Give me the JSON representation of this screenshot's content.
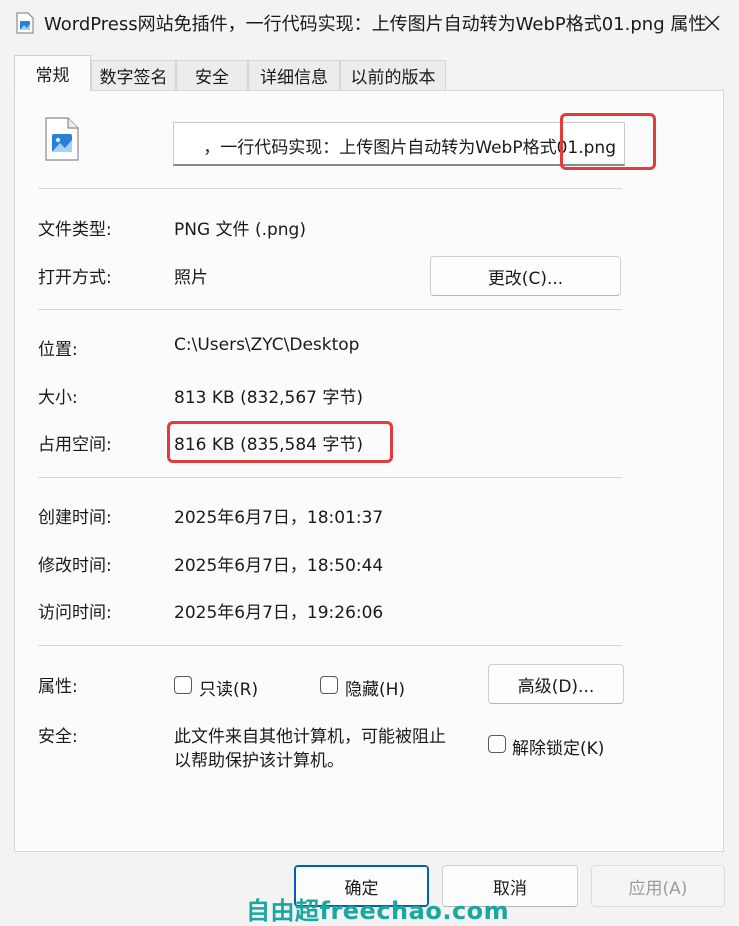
{
  "window": {
    "title": "WordPress网站免插件，一行代码实现：上传图片自动转为WebP格式01.png 属性",
    "close_icon": "close-icon"
  },
  "tabs": [
    {
      "label": "常规",
      "active": true
    },
    {
      "label": "数字签名",
      "active": false
    },
    {
      "label": "安全",
      "active": false
    },
    {
      "label": "详细信息",
      "active": false
    },
    {
      "label": "以前的版本",
      "active": false
    }
  ],
  "file": {
    "icon": "image-file-icon",
    "name_visible": "，一行代码实现：上传图片自动转为WebP格式01.png"
  },
  "info": {
    "type_label": "文件类型:",
    "type_value": "PNG 文件 (.png)",
    "open_label": "打开方式:",
    "open_value": "照片",
    "change_button": "更改(C)...",
    "location_label": "位置:",
    "location_value": "C:\\Users\\ZYC\\Desktop",
    "size_label": "大小:",
    "size_value": "813 KB (832,567 字节)",
    "disk_label": "占用空间:",
    "disk_value": "816 KB (835,584 字节)",
    "created_label": "创建时间:",
    "created_value": "2025年6月7日，18:01:37",
    "modified_label": "修改时间:",
    "modified_value": "2025年6月7日，18:50:44",
    "accessed_label": "访问时间:",
    "accessed_value": "2025年6月7日，19:26:06"
  },
  "attributes": {
    "label": "属性:",
    "readonly": {
      "label": "只读(R)",
      "checked": false
    },
    "hidden": {
      "label": "隐藏(H)",
      "checked": false
    },
    "advanced_button": "高级(D)..."
  },
  "security": {
    "label": "安全:",
    "text_line1": "此文件来自其他计算机，可能被阻止",
    "text_line2": "以帮助保护该计算机。",
    "unblock": {
      "label": "解除锁定(K)",
      "checked": false
    }
  },
  "footer": {
    "ok": "确定",
    "cancel": "取消",
    "apply": "应用(A)"
  },
  "watermark": "自由超freechao.com",
  "colors": {
    "highlight": "#e23b3b",
    "accent": "#005fb8",
    "watermark": "#19a7a0"
  }
}
